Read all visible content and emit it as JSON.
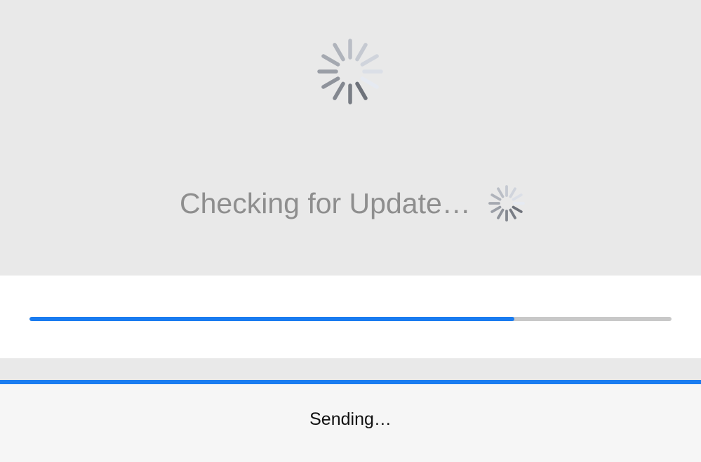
{
  "status": {
    "message": "Checking for Update…"
  },
  "progress": {
    "fraction": 0.755,
    "fill_color": "#1a7cf0",
    "track_color": "#c8c8c8"
  },
  "footer": {
    "message": "Sending…",
    "accent_color": "#1a7cf0"
  },
  "icons": {
    "large": "activity-spinner-icon",
    "small": "activity-spinner-icon"
  }
}
